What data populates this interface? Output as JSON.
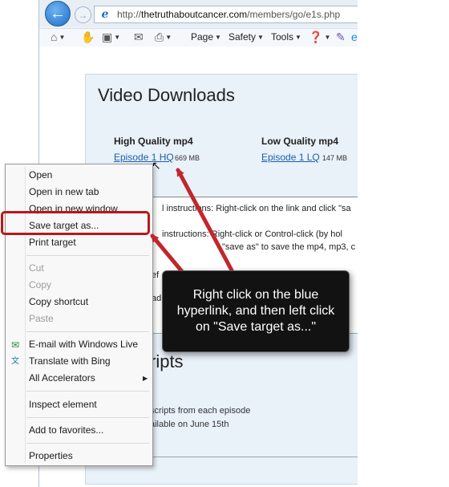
{
  "browser": {
    "url_prefix": "http://",
    "url_domain": "thetruthaboutcancer.com",
    "url_path": "/members/go/e1s.php",
    "commands": {
      "page": "Page",
      "safety": "Safety",
      "tools": "Tools"
    },
    "icons": [
      "back-icon",
      "forward-icon",
      "home-icon",
      "hand-icon",
      "rss-icon",
      "mail-icon",
      "print-icon",
      "help-icon",
      "ie-icon"
    ]
  },
  "page": {
    "title": "Video Downloads",
    "high_quality": {
      "heading": "High Quality mp4",
      "link": "Episode 1 HQ",
      "size": "669 MB"
    },
    "low_quality": {
      "heading": "Low Quality mp4",
      "link": "Episode 1 LQ",
      "size": "147 MB"
    },
    "instructions": {
      "line1": "l instructions: Right-click on the link and click \"sa",
      "line2": "instructions: Right-click or Control-click (by hol",
      "line3": "\"save as\" to save the mp4, mp3, c",
      "fragment1": "ef",
      "fragment2": "ad"
    },
    "transcripts": {
      "title": "ripts",
      "line1": "scripts from each episode",
      "line2": "ailable on June 15th"
    }
  },
  "context_menu": {
    "items": [
      {
        "label": "Open",
        "enabled": true
      },
      {
        "label": "Open in new tab",
        "enabled": true
      },
      {
        "label": "Open in new window",
        "enabled": true
      },
      {
        "label": "Save target as...",
        "enabled": true
      },
      {
        "label": "Print target",
        "enabled": true
      },
      {
        "label": "Cut",
        "enabled": false
      },
      {
        "label": "Copy",
        "enabled": false
      },
      {
        "label": "Copy shortcut",
        "enabled": true
      },
      {
        "label": "Paste",
        "enabled": false
      },
      {
        "label": "E-mail with Windows Live",
        "enabled": true
      },
      {
        "label": "Translate with Bing",
        "enabled": true
      },
      {
        "label": "All Accelerators",
        "enabled": true
      },
      {
        "label": "Inspect element",
        "enabled": true
      },
      {
        "label": "Add to favorites...",
        "enabled": true
      },
      {
        "label": "Properties",
        "enabled": true
      }
    ]
  },
  "annotation": {
    "callout": "Right click on the blue hyperlink, and then left click on \"Save target as...\"",
    "arrow_color": "#c0272d",
    "highlight_color": "#b8181b"
  }
}
